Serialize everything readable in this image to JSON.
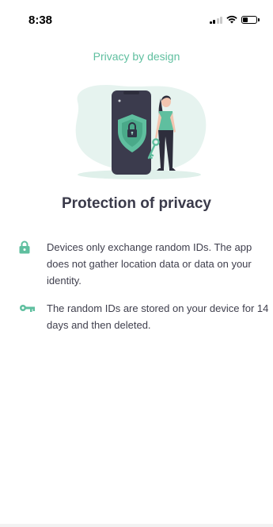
{
  "status_bar": {
    "time": "8:38",
    "battery_level": 0.4
  },
  "page": {
    "subtitle": "Privacy by design",
    "heading": "Protection of privacy",
    "items": [
      {
        "icon": "lock-icon",
        "text": "Devices only exchange random IDs. The app does not gather location data or data on your identity."
      },
      {
        "icon": "key-icon",
        "text": "The random IDs are stored on your device for 14 days and then deleted."
      }
    ]
  },
  "colors": {
    "accent": "#5fbf9f",
    "heading": "#3a3a4a",
    "phone": "#3b3b4d",
    "blob": "#e6f3ef"
  }
}
